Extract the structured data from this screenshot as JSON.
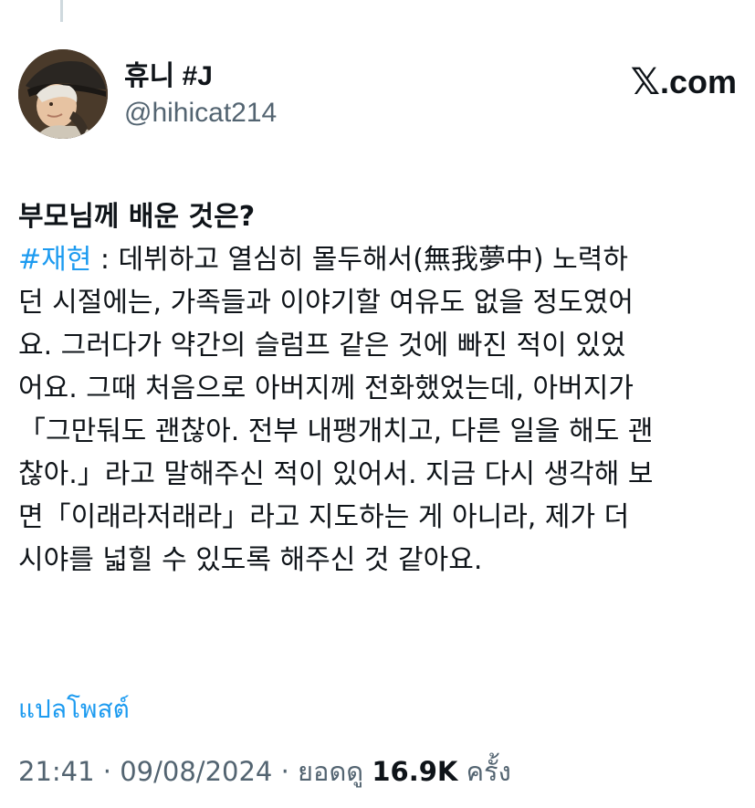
{
  "header": {
    "display_name": "휴니 #J",
    "handle": "@hihicat214",
    "brand_x": "𝕏",
    "brand_text": ".com"
  },
  "tweet": {
    "title": "부모님께 배운 것은?",
    "hashtag": "#재현",
    "line1_rest": " : 데뷔하고 열심히 몰두해서(無我夢中) 노력하",
    "lines": [
      "던 시절에는, 가족들과 이야기할 여유도 없을 정도였어",
      "요. 그러다가 약간의 슬럼프 같은 것에 빠진 적이 있었",
      "어요. 그때 처음으로 아버지께 전화했었는데, 아버지가",
      "「그만둬도 괜찮아. 전부 내팽개치고, 다른 일을 해도 괜",
      "찮아.」라고 말해주신 적이 있어서. 지금 다시 생각해 보",
      "면「이래라저래라」라고 지도하는 게 아니라, 제가 더",
      "시야를 넓힐 수 있도록 해주신 것 같아요."
    ]
  },
  "translate_label": "แปลโพสต์",
  "meta": {
    "time": "21:41",
    "separator": " · ",
    "date": "09/08/2024",
    "views_label": "ยอดดู",
    "views_count": "16.9K",
    "views_unit": "ครั้ง"
  },
  "colors": {
    "link": "#1d9bf0",
    "text": "#0f1419",
    "secondary": "#536471"
  }
}
